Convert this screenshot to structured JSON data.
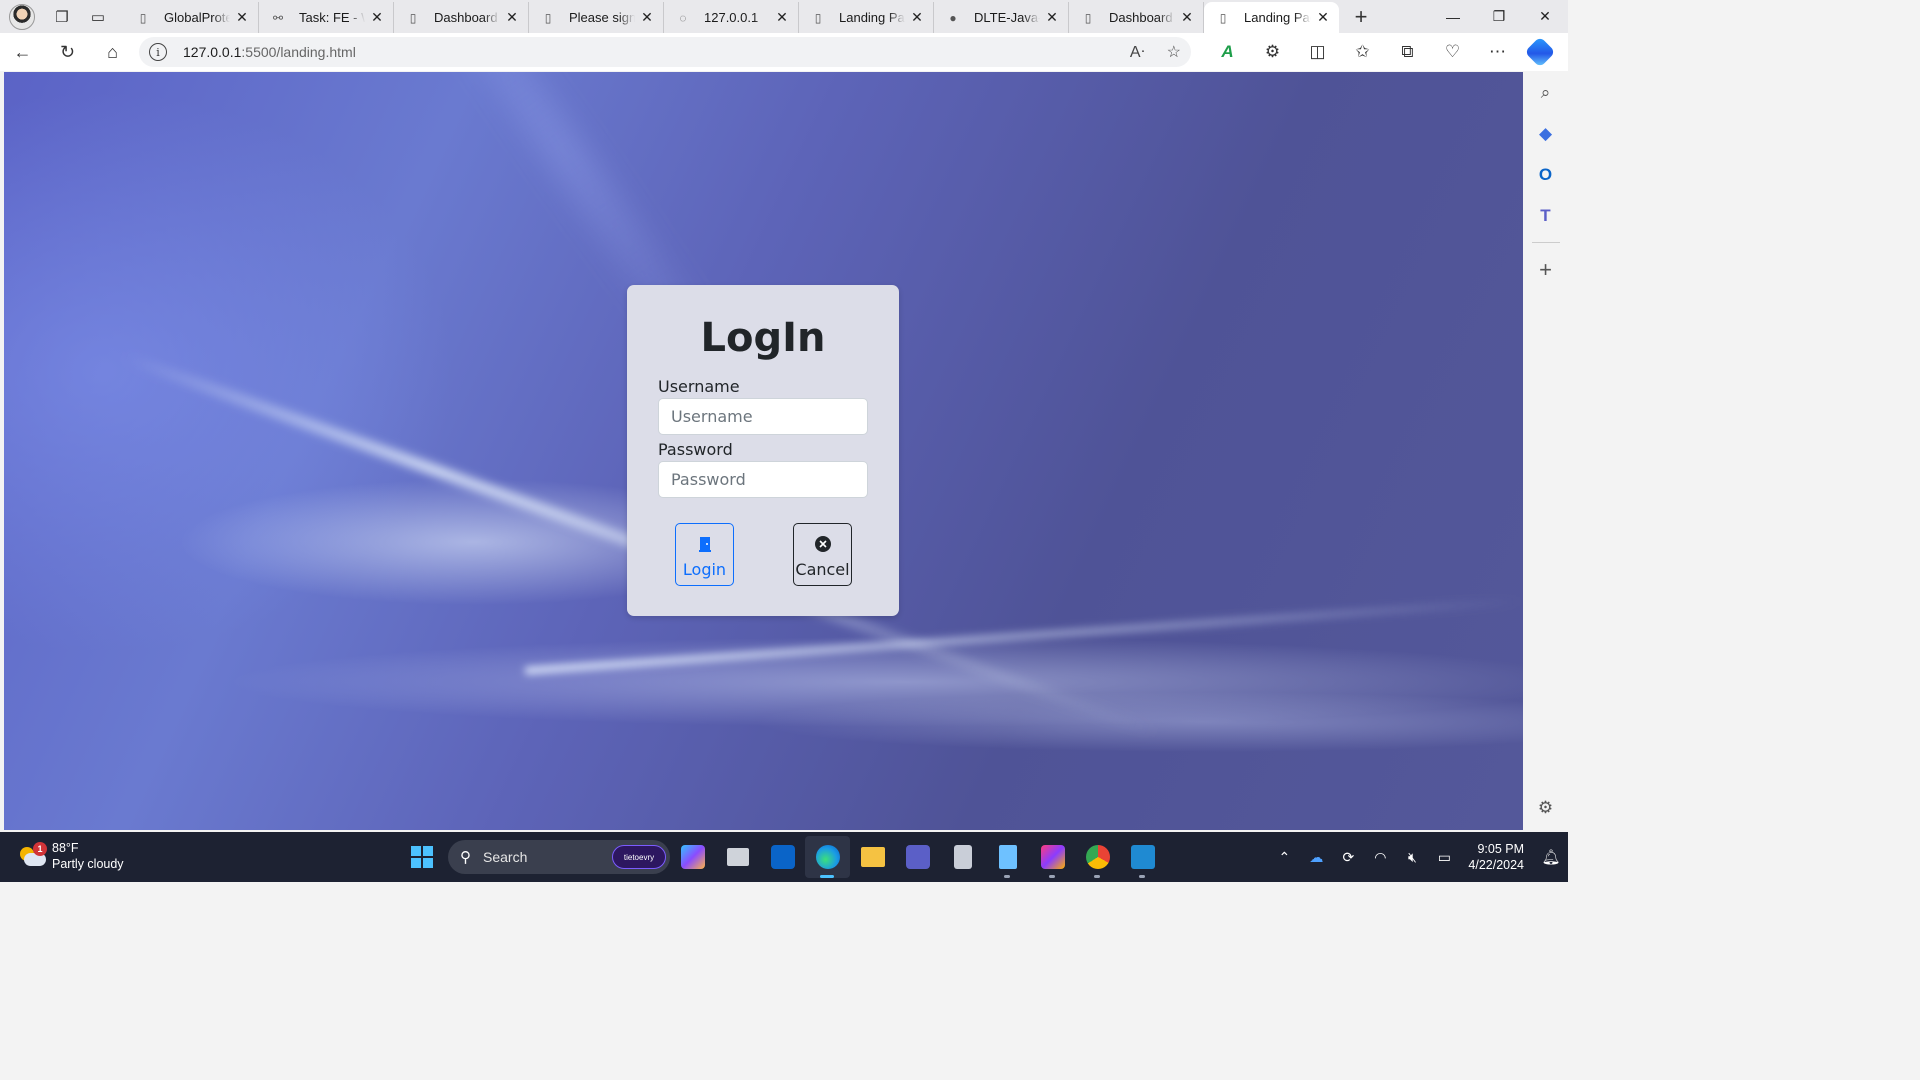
{
  "browser": {
    "tabs": [
      {
        "title": "GlobalProtect",
        "icon": "page-icon"
      },
      {
        "title": "Task: FE - Web",
        "icon": "link-icon"
      },
      {
        "title": "Dashboard",
        "icon": "page-icon"
      },
      {
        "title": "Please sign in",
        "icon": "page-icon"
      },
      {
        "title": "127.0.0.1",
        "icon": "loading-page-icon"
      },
      {
        "title": "Landing Page",
        "icon": "page-icon"
      },
      {
        "title": "DLTE-Java-Fu",
        "icon": "github-icon"
      },
      {
        "title": "Dashboard",
        "icon": "page-icon"
      },
      {
        "title": "Landing Page",
        "icon": "page-icon",
        "active": true
      }
    ],
    "url_host": "127.0.0.1",
    "url_path": ":5500/landing.html"
  },
  "login": {
    "title": "LogIn",
    "username_label": "Username",
    "username_placeholder": "Username",
    "password_label": "Password",
    "password_placeholder": "Password",
    "login_button": "Login",
    "cancel_button": "Cancel"
  },
  "taskbar": {
    "weather_temp": "88°F",
    "weather_desc": "Partly cloudy",
    "weather_badge": "1",
    "search_label": "Search",
    "search_pill": "tietoevry",
    "time": "9:05 PM",
    "date": "4/22/2024"
  },
  "colors": {
    "primary": "#0d6efd",
    "card_bg": "#dcdde8",
    "taskbar_bg": "#1d2232"
  }
}
